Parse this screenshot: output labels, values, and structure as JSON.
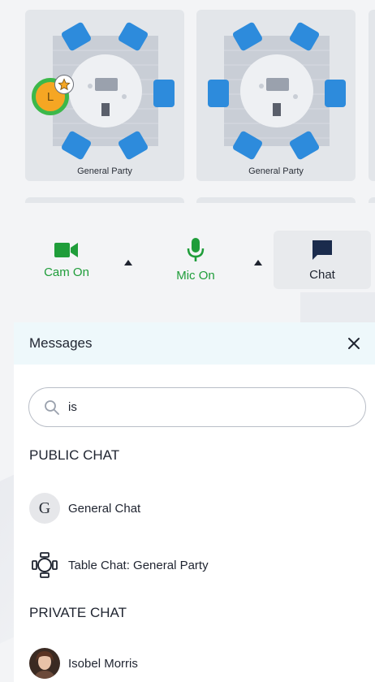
{
  "rooms": [
    {
      "label": "General Party",
      "occupant_initial": "L"
    },
    {
      "label": "General Party"
    }
  ],
  "toolbar": {
    "cam_label": "Cam On",
    "mic_label": "Mic On",
    "chat_label": "Chat",
    "accent": "#1f9d3a"
  },
  "messages": {
    "title": "Messages",
    "search": {
      "value": "is",
      "placeholder": ""
    },
    "public_title": "PUBLIC CHAT",
    "public": [
      {
        "avatar": "G",
        "name": "General Chat"
      },
      {
        "icon": "table-icon",
        "name": "Table Chat: General Party"
      }
    ],
    "private_title": "PRIVATE CHAT",
    "private": [
      {
        "avatar": "photo",
        "name": "Isobel Morris"
      }
    ]
  }
}
